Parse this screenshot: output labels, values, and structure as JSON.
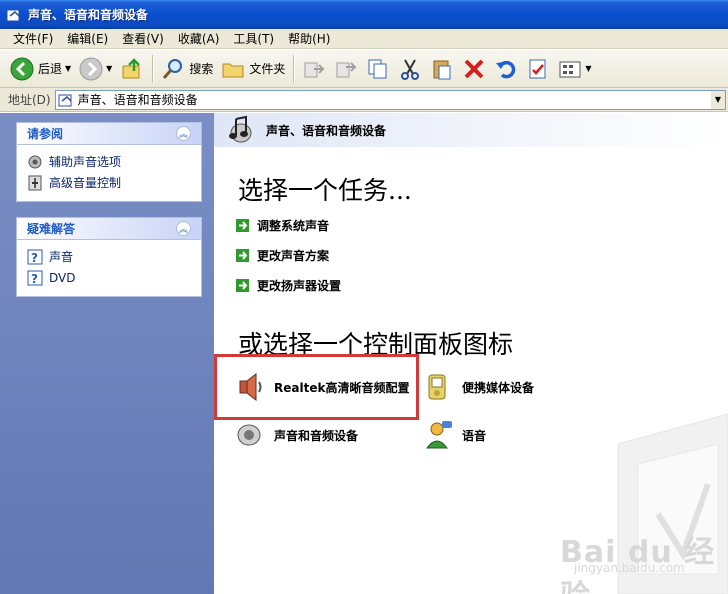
{
  "window": {
    "title": "声音、语音和音频设备"
  },
  "menu": [
    "文件(F)",
    "编辑(E)",
    "查看(V)",
    "收藏(A)",
    "工具(T)",
    "帮助(H)"
  ],
  "toolbar": {
    "back": "后退",
    "search": "搜索",
    "folders": "文件夹"
  },
  "address": {
    "label": "地址(D)",
    "value": "声音、语音和音频设备"
  },
  "left": {
    "see_also": {
      "title": "请参阅",
      "items": [
        "辅助声音选项",
        "高级音量控制"
      ]
    },
    "troubleshoot": {
      "title": "疑难解答",
      "items": [
        "声音",
        "DVD"
      ]
    }
  },
  "main": {
    "header": "声音、语音和音频设备",
    "pick_task": "选择一个任务...",
    "tasks": [
      "调整系统声音",
      "更改声音方案",
      "更改扬声器设置"
    ],
    "pick_icon": "或选择一个控制面板图标",
    "icons": [
      "Realtek高清晰音频配置",
      "便携媒体设备",
      "声音和音频设备",
      "语音"
    ]
  },
  "watermark": {
    "brand": "Bai du 经验",
    "url": "jingyan.baidu.com"
  }
}
